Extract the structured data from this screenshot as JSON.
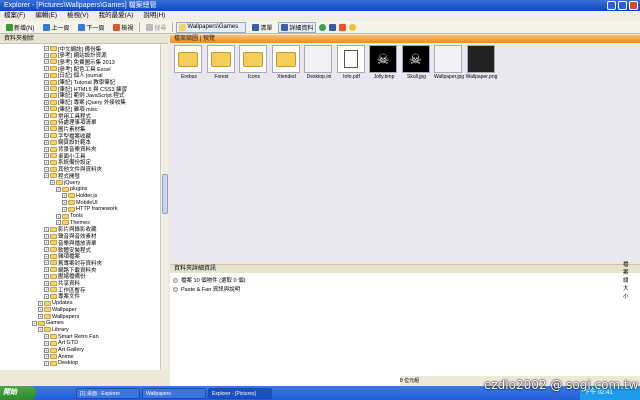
{
  "window": {
    "title": "Explorer - [Pictures\\Wallpapers\\Games] 檔案總管"
  },
  "menu": [
    "檔案(F)",
    "編輯(E)",
    "檢視(V)",
    "我的最愛(A)",
    "說明(H)"
  ],
  "toolbar": {
    "new": "新增(N)",
    "back": "上一頁",
    "forward": "下一頁",
    "views": "檢視",
    "search": "搜尋",
    "address_value": "Wallpapers\\Games",
    "list": "清單",
    "details": "詳細資料"
  },
  "left_header": "資料夾樹狀",
  "tree": [
    "[中文網誌] 備份集",
    "[參考] 網站設計資源",
    "[參考] 免費圖示集 2013",
    "[參考] 配色工具 Excel",
    "[日記] 個人 journal",
    "[筆記] Tutorial 教學筆記",
    "[筆記] HTML5 與 CSS3 練習",
    "[筆記] 範例 JavaScript 程式",
    "[筆記] 專案 jQuery 外掛收集",
    "[筆記] 雜項 misc",
    "常用工具程式",
    "待處理事項清單",
    "圖片素材集",
    "字型檔案收藏",
    "網頁設計範本",
    "背景音樂資料夾",
    "桌面小工具",
    "系統備份設定",
    "其他文件與資料夾",
    "程式開發",
    "jQuery",
    "plugins",
    "Holder.js",
    "MobileUI",
    "HTTP framework",
    "Tools",
    "Themes",
    "影片與錄影收藏",
    "聲音與音效素材",
    "音樂與播放清單",
    "軟體安裝程式",
    "雜項檔案",
    "舊專案封存資料夾",
    "網路下載資料夾",
    "壓縮檔備份",
    "共享資料",
    "工作區暫存",
    "專案文件",
    "Updates",
    "Wallpaper",
    "Wallpapers",
    "Games",
    "Library",
    "Smart Retro Fan",
    "Art GTD",
    "Art Gallery",
    "Anime",
    "Desktop"
  ],
  "right_header": "檔案縮圖 | 預覽",
  "thumbnails": [
    {
      "label": "Erebus",
      "kind": "folder"
    },
    {
      "label": "Forest",
      "kind": "folder"
    },
    {
      "label": "Icons",
      "kind": "folder"
    },
    {
      "label": "Xtended",
      "kind": "folder"
    },
    {
      "label": "Desktop.ini",
      "kind": "blank"
    },
    {
      "label": "Info.pdf",
      "kind": "doc"
    },
    {
      "label": "Jolly.bmp",
      "kind": "pirate"
    },
    {
      "label": "Skull.jpg",
      "kind": "pirate"
    },
    {
      "label": "Wallpaper.jpg",
      "kind": "blank"
    },
    {
      "label": "Wallpaper.png",
      "kind": "dark"
    }
  ],
  "props": {
    "header": "資料夾詳細資訊",
    "rows": [
      "檔案 10 個物件 (選取 0 個)",
      "Paste & Fan 資訊與說明"
    ],
    "right_label": "檔案總大小"
  },
  "status": "8 位元組",
  "taskbar": {
    "start": "開始",
    "tasks": [
      "[1] 桌面 - Explorer",
      "Wallpapers",
      "Explorer - [Pictures]"
    ],
    "clock": "下午 02:41"
  },
  "watermark": "ezdio2002 @ sogi.com.tw"
}
